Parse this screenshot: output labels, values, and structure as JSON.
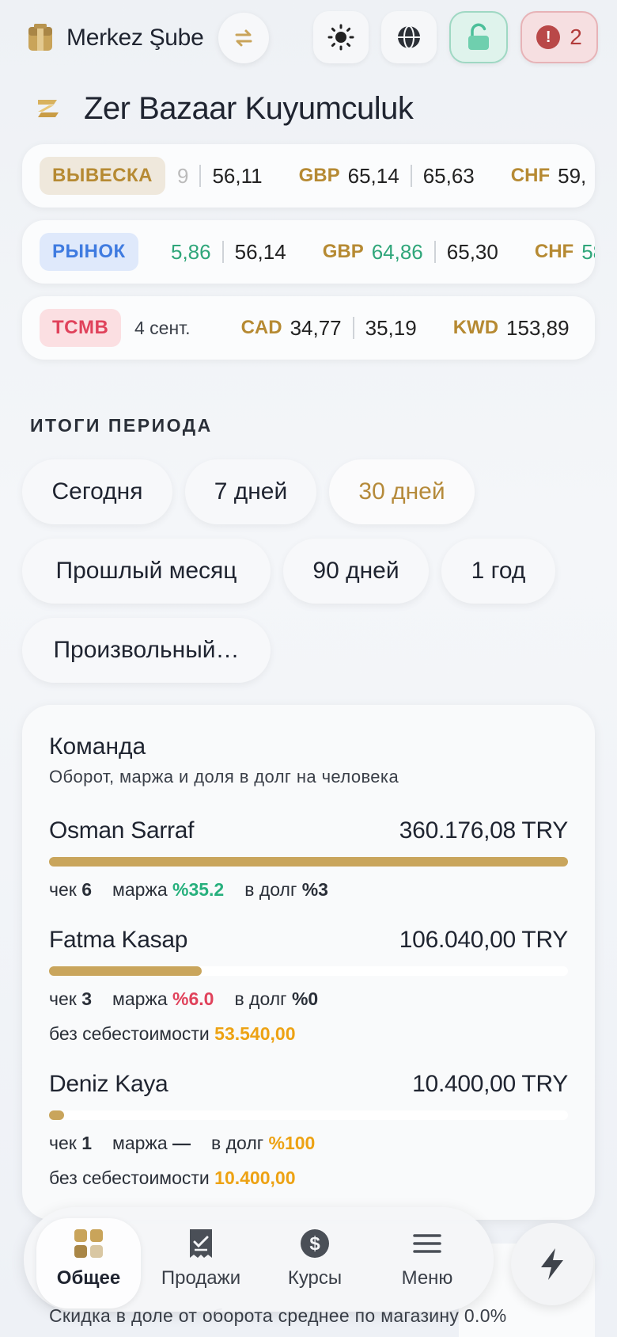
{
  "header": {
    "branch_name": "Merkez Şube",
    "brand_title": "Zer Bazaar Kuyumculuk",
    "alerts_count": "2",
    "icons": [
      "store-icon",
      "swap-icon",
      "sun-icon",
      "globe-icon",
      "unlock-icon",
      "alert-icon"
    ]
  },
  "tickers": [
    {
      "tag": "ВЫВЕСКА",
      "items": [
        {
          "cur": "",
          "val1": "9",
          "val2": "56,11"
        },
        {
          "cur": "GBP",
          "val1": "65,14",
          "val2": "65,63"
        },
        {
          "cur": "CHF",
          "val1": "59,",
          "val2": ""
        }
      ]
    },
    {
      "tag": "РЫНОК",
      "items": [
        {
          "cur": "",
          "val1": "5,86",
          "val2": "56,14"
        },
        {
          "cur": "GBP",
          "val1": "64,86",
          "val2": "65,30"
        },
        {
          "cur": "CHF",
          "val1": "58",
          "val2": ""
        }
      ]
    },
    {
      "tag": "TCMB",
      "date": "4 сент.",
      "items": [
        {
          "cur": "CAD",
          "val1": "34,77",
          "val2": "35,19"
        },
        {
          "cur": "KWD",
          "val1": "153,89",
          "val2": ""
        }
      ]
    }
  ],
  "period": {
    "title": "ИТОГИ ПЕРИОДА",
    "options": [
      "Сегодня",
      "7 дней",
      "30 дней",
      "Прошлый месяц",
      "90 дней",
      "1 год",
      "Произвольный…"
    ],
    "selected": "30 дней"
  },
  "team": {
    "title": "Команда",
    "subtitle": "Оборот, маржа и доля в долг на человека",
    "labels": {
      "check": "чек",
      "margin": "маржа",
      "debt": "в долг",
      "no_cost": "без себестоимости"
    },
    "members": [
      {
        "name": "Osman Sarraf",
        "amount": "360.176,08 TRY",
        "share": 1.0,
        "checks": "6",
        "margin": "%35.2",
        "debt": "%3",
        "no_cost": ""
      },
      {
        "name": "Fatma Kasap",
        "amount": "106.040,00 TRY",
        "share": 0.294,
        "checks": "3",
        "margin": "%6.0",
        "debt": "%0",
        "no_cost": "53.540,00"
      },
      {
        "name": "Deniz Kaya",
        "amount": "10.400,00 TRY",
        "share": 0.029,
        "checks": "1",
        "margin": "—",
        "debt": "%100",
        "no_cost": "10.400,00"
      }
    ]
  },
  "footer_text": "Скидка в доле от оборота среднее по магазину 0.0%",
  "nav": {
    "items": [
      {
        "label": "Общее",
        "icon": "dashboard-icon"
      },
      {
        "label": "Продажи",
        "icon": "receipt-icon"
      },
      {
        "label": "Курсы",
        "icon": "dollar-icon"
      },
      {
        "label": "Меню",
        "icon": "menu-icon"
      }
    ],
    "active": "Общее"
  },
  "colors": {
    "accent_gold": "#b68a33",
    "green": "#27b07d",
    "red": "#e0425b",
    "amber": "#eda213",
    "bar": "#c9a55c"
  }
}
